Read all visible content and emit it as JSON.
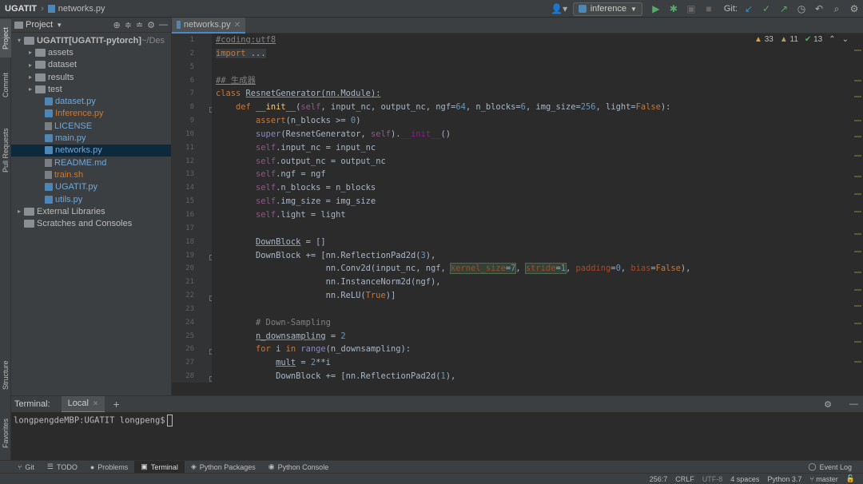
{
  "nav": {
    "project": "UGATIT",
    "file": "networks.py",
    "run_config": "inference",
    "git_label": "Git:"
  },
  "sidebar_tabs": {
    "project": "Project",
    "commit": "Commit",
    "pull_requests": "Pull Requests",
    "structure": "Structure",
    "favorites": "Favorites"
  },
  "project_panel": {
    "title": "Project",
    "items": [
      {
        "label": "UGATIT",
        "extra": " [UGATIT-pytorch]",
        "path": " ~/Des",
        "type": "root"
      },
      {
        "label": "assets",
        "type": "folder"
      },
      {
        "label": "dataset",
        "type": "folder"
      },
      {
        "label": "results",
        "type": "folder"
      },
      {
        "label": "test",
        "type": "folder"
      },
      {
        "label": "dataset.py",
        "type": "py"
      },
      {
        "label": "Inference.py",
        "type": "py",
        "color": "orange"
      },
      {
        "label": "LICENSE",
        "type": "txt"
      },
      {
        "label": "main.py",
        "type": "py"
      },
      {
        "label": "networks.py",
        "type": "py",
        "selected": true
      },
      {
        "label": "README.md",
        "type": "txt"
      },
      {
        "label": "train.sh",
        "type": "txt",
        "color": "orange"
      },
      {
        "label": "UGATIT.py",
        "type": "py"
      },
      {
        "label": "utils.py",
        "type": "py"
      },
      {
        "label": "External Libraries",
        "type": "lib"
      },
      {
        "label": "Scratches and Consoles",
        "type": "scratch"
      }
    ]
  },
  "editor": {
    "tab": "networks.py",
    "inspections": {
      "warnings": "33",
      "weak": "11",
      "ok": "13"
    },
    "line_numbers": [
      "1",
      "2",
      "5",
      "6",
      "7",
      "8",
      "9",
      "10",
      "11",
      "12",
      "13",
      "14",
      "15",
      "16",
      "17",
      "18",
      "19",
      "20",
      "21",
      "22",
      "23",
      "24",
      "25",
      "26",
      "27",
      "28"
    ]
  },
  "terminal": {
    "title": "Terminal:",
    "tab": "Local",
    "prompt": "longpengdeMBP:UGATIT longpeng$"
  },
  "toolwindows": [
    "Git",
    "TODO",
    "Problems",
    "Terminal",
    "Python Packages",
    "Python Console"
  ],
  "event_log": "Event Log",
  "status": {
    "position": "256:7",
    "line_sep": "CRLF",
    "encoding": "UTF-8",
    "indent": "4 spaces",
    "interpreter": "Python 3.7",
    "branch": "master"
  }
}
